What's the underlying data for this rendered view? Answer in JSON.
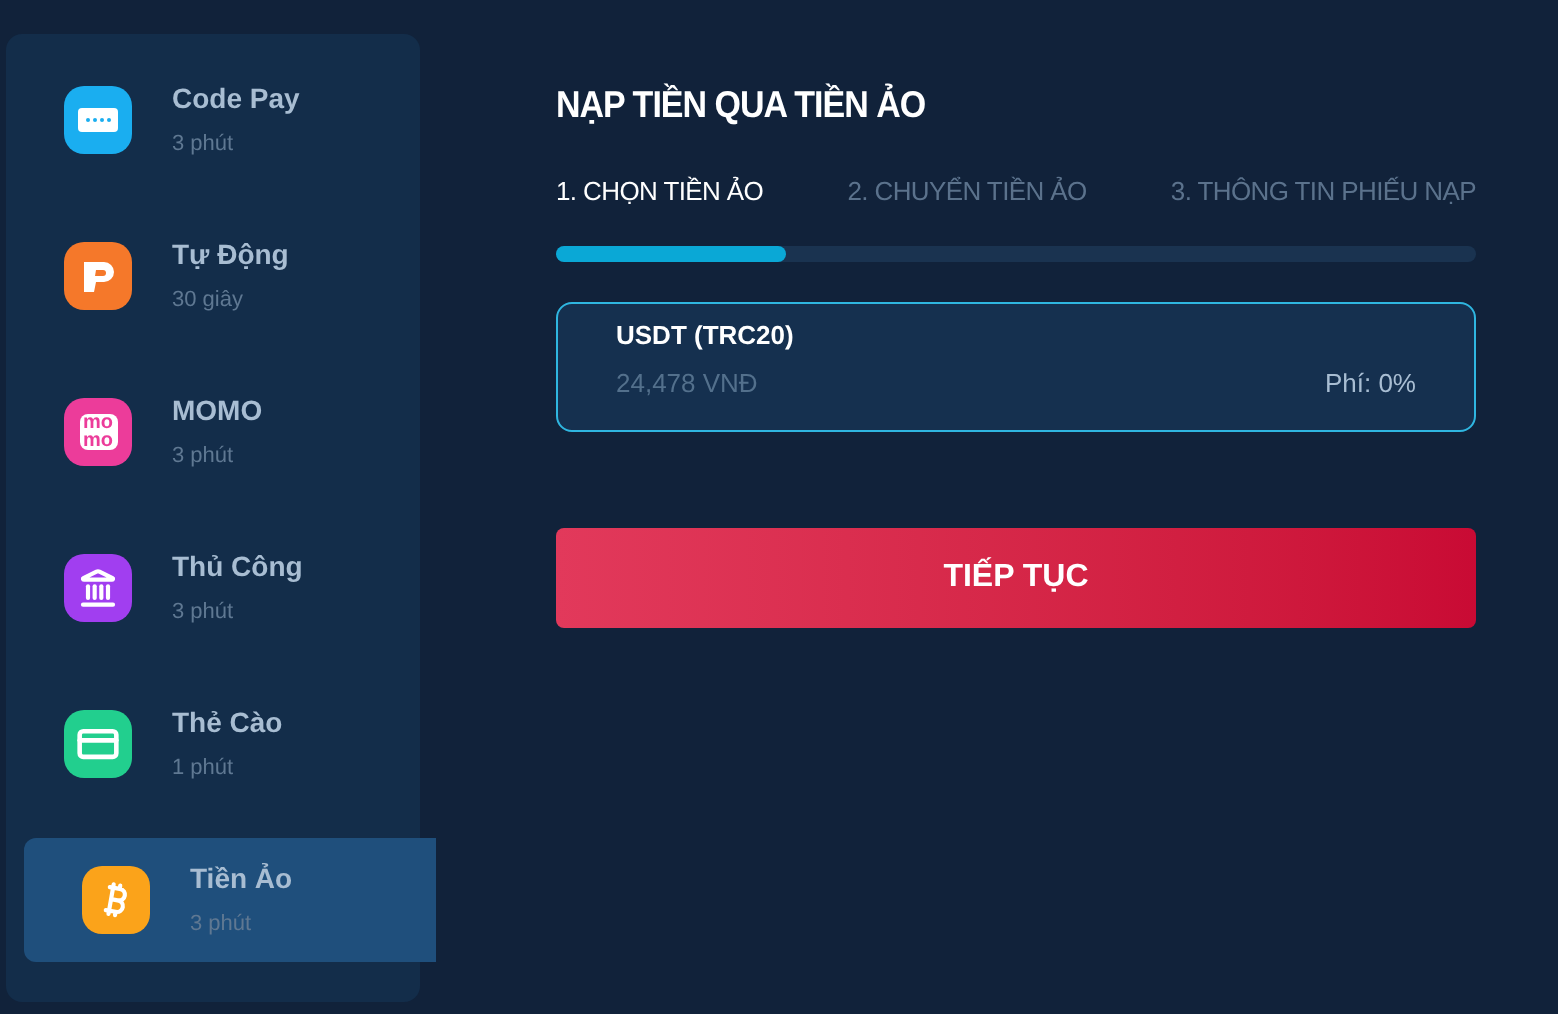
{
  "sidebar": {
    "items": [
      {
        "name": "Code Pay",
        "time": "3 phút",
        "kind": "keypad",
        "color": "#1aaef0",
        "selected": false
      },
      {
        "name": "Tự Động",
        "time": "30 giây",
        "kind": "plogo",
        "color": "#f5782a",
        "selected": false
      },
      {
        "name": "MOMO",
        "time": "3 phút",
        "kind": "momo",
        "color": "#ec3c9a",
        "logo": [
          "mo",
          "mo"
        ],
        "selected": false
      },
      {
        "name": "Thủ Công",
        "time": "3 phút",
        "kind": "bank",
        "color": "#a13ef0",
        "selected": false
      },
      {
        "name": "Thẻ Cào",
        "time": "1 phút",
        "kind": "card",
        "color": "#22cf8e",
        "selected": false
      },
      {
        "name": "Tiền Ảo",
        "time": "3 phút",
        "kind": "bitcoin",
        "color": "#fba31a",
        "selected": true
      }
    ]
  },
  "main": {
    "title": "NẠP TIỀN QUA TIỀN ẢO",
    "steps": [
      {
        "label": "1. CHỌN TIỀN ẢO",
        "selected": true
      },
      {
        "label": "2. CHUYỂN TIỀN ẢO",
        "selected": false
      },
      {
        "label": "3. THÔNG TIN PHIẾU NẠP",
        "selected": false
      }
    ],
    "progress": {
      "level": 0.25
    },
    "coins": [
      {
        "name": "USDT (TRC20)",
        "rate": "24,478 VNĐ",
        "fee": "Phí: 0%",
        "selected": true
      }
    ],
    "button": "TIẾP TỤC"
  }
}
